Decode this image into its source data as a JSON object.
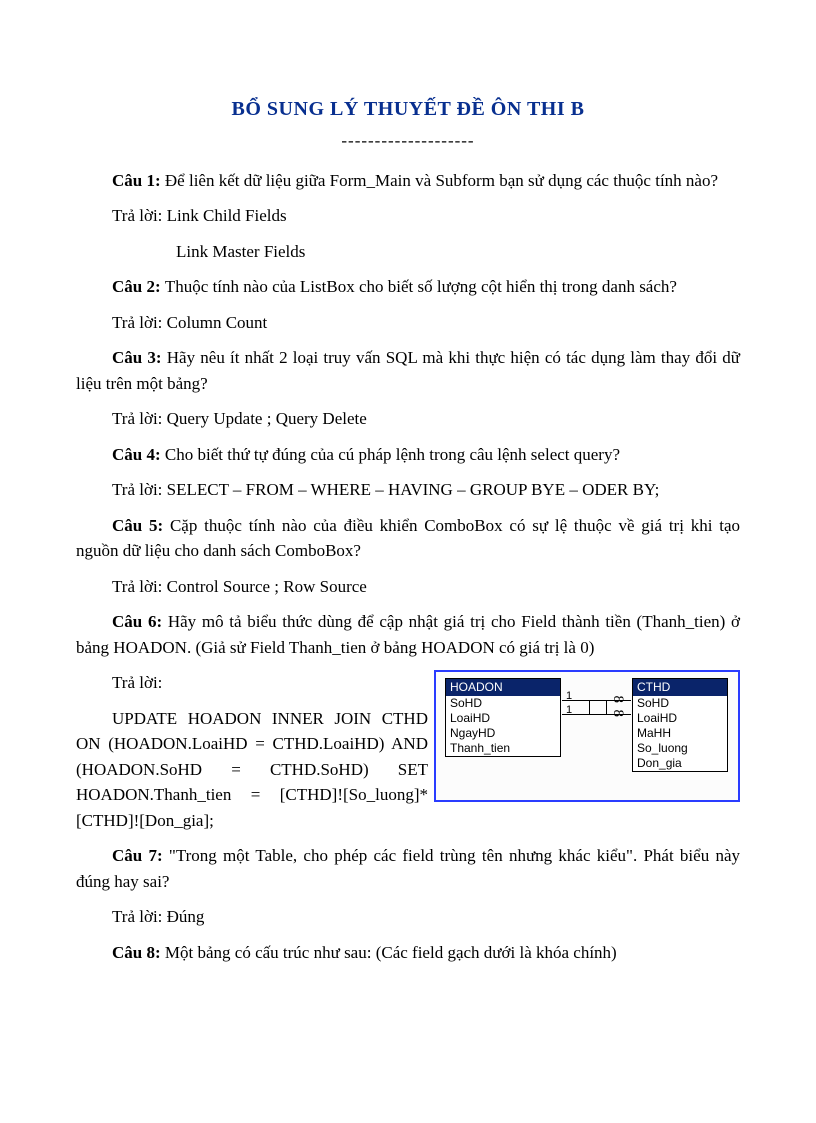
{
  "title": "BỔ SUNG LÝ THUYẾT ĐỀ ÔN THI B",
  "divider": "--------------------",
  "q1_label": "Câu 1: ",
  "q1_text": "Để liên kết dữ liệu giữa Form_Main và Subform bạn sử dụng các thuộc tính nào?",
  "q1_a1": "Trả lời: Link Child Fields",
  "q1_a2": "Link Master Fields",
  "q2_label": "Câu 2: ",
  "q2_text": "Thuộc tính nào của ListBox cho biết số lượng cột hiển thị trong danh sách?",
  "q2_a": "Trả lời: Column Count",
  "q3_label": "Câu 3: ",
  "q3_text": "Hãy nêu ít nhất 2 loại truy vấn SQL mà khi thực hiện có tác dụng làm thay đổi dữ liệu trên một bảng?",
  "q3_a": "Trả lời: Query Update ; Query Delete",
  "q4_label": "Câu 4: ",
  "q4_text": "Cho biết thứ tự đúng của cú pháp lệnh trong câu lệnh select query?",
  "q4_a": "Trả lời: SELECT – FROM – WHERE – HAVING – GROUP BYE – ODER BY;",
  "q5_label": "Câu 5: ",
  "q5_text": "Cặp thuộc tính nào của điều khiển ComboBox có sự lệ thuộc về giá trị khi tạo nguồn dữ liệu cho danh sách ComboBox?",
  "q5_a": "Trả lời: Control Source ; Row Source",
  "q6_label": "Câu 6: ",
  "q6_text": "Hãy mô tả biểu thức dùng để cập nhật giá trị cho Field thành tiền (Thanh_tien) ở bảng HOADON. (Giả sử Field Thanh_tien ở bảng HOADON có giá trị là 0)",
  "q6_a_label": "Trả lời:",
  "q6_sql": "UPDATE HOADON INNER JOIN CTHD ON (HOADON.LoaiHD = CTHD.LoaiHD) AND (HOADON.SoHD = CTHD.SoHD) SET HOADON.Thanh_tien = [CTHD]![So_luong]*[CTHD]![Don_gia];",
  "q7_label": "Câu 7: ",
  "q7_text": "\"Trong một Table, cho phép các field trùng tên nhưng khác kiểu\". Phát biểu này đúng hay sai?",
  "q7_a": "Trả lời: Đúng",
  "q8_label": "Câu 8: ",
  "q8_text": "Một bảng có cấu trúc như sau: (Các field gạch dưới là khóa chính)",
  "diagram": {
    "t1": {
      "head": "HOADON",
      "rows": [
        "SoHD",
        "LoaiHD",
        "NgayHD",
        "Thanh_tien"
      ]
    },
    "t2": {
      "head": "CTHD",
      "rows": [
        "SoHD",
        "LoaiHD",
        "MaHH",
        "So_luong",
        "Don_gia"
      ]
    },
    "rel1": "1",
    "rel2": "1",
    "inf": "8"
  }
}
